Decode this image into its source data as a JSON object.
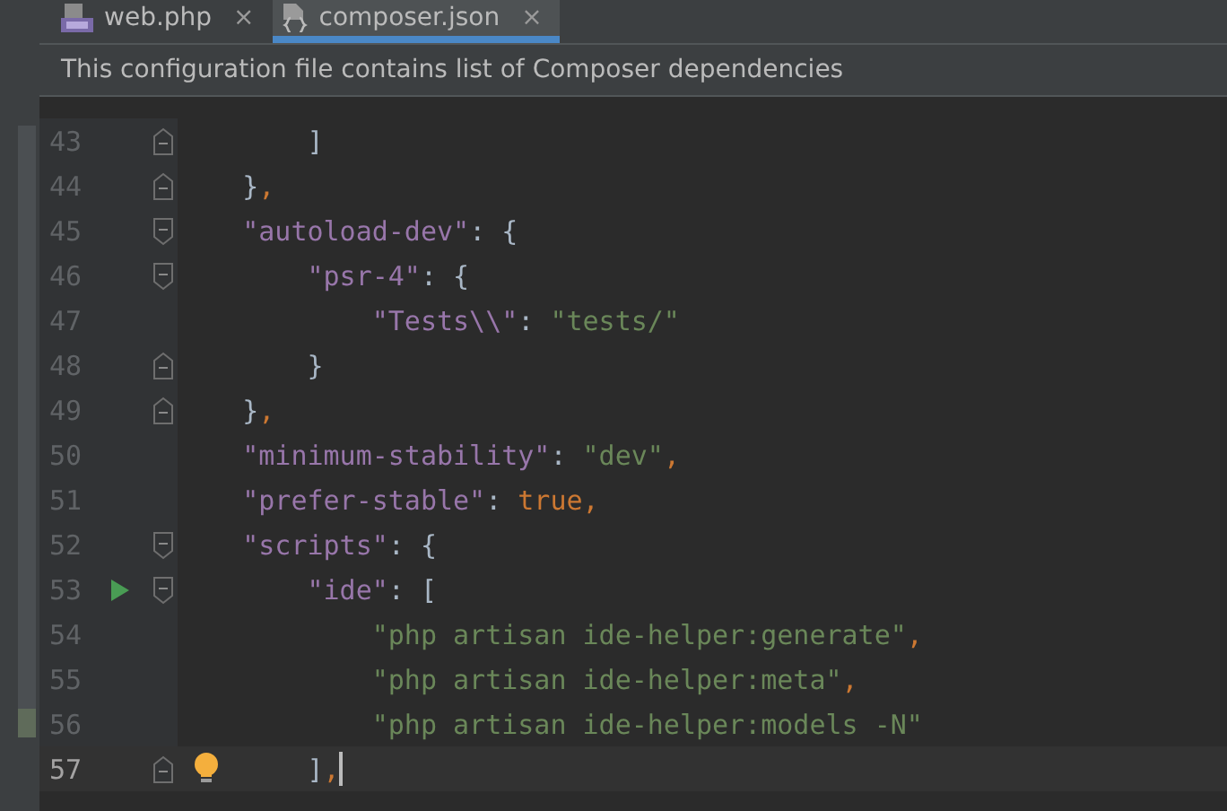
{
  "tabs": [
    {
      "label": "web.php",
      "kind": "php",
      "close": "×",
      "selected": false
    },
    {
      "label": "composer.json",
      "kind": "json",
      "close": "×",
      "selected": true
    }
  ],
  "banner": {
    "text": "This configuration file contains list of Composer dependencies"
  },
  "lines": [
    {
      "number": "43",
      "fold_open": false,
      "fold_close": true,
      "run": false,
      "current": false,
      "bulb": false,
      "tokens": [
        {
          "kind": "plain",
          "text": "        ]"
        }
      ]
    },
    {
      "number": "44",
      "fold_open": false,
      "fold_close": true,
      "run": false,
      "current": false,
      "bulb": false,
      "tokens": [
        {
          "kind": "plain",
          "text": "    }"
        },
        {
          "kind": "punct",
          "text": ","
        }
      ]
    },
    {
      "number": "45",
      "fold_open": true,
      "fold_close": false,
      "run": false,
      "current": false,
      "bulb": false,
      "tokens": [
        {
          "kind": "key",
          "text": "    \"autoload-dev\""
        },
        {
          "kind": "colon",
          "text": ": "
        },
        {
          "kind": "plain",
          "text": "{"
        }
      ]
    },
    {
      "number": "46",
      "fold_open": true,
      "fold_close": false,
      "run": false,
      "current": false,
      "bulb": false,
      "tokens": [
        {
          "kind": "key",
          "text": "        \"psr-4\""
        },
        {
          "kind": "colon",
          "text": ": "
        },
        {
          "kind": "plain",
          "text": "{"
        }
      ]
    },
    {
      "number": "47",
      "fold_open": false,
      "fold_close": false,
      "run": false,
      "current": false,
      "bulb": false,
      "tokens": [
        {
          "kind": "key",
          "text": "            \"Tests\\\\\""
        },
        {
          "kind": "colon",
          "text": ": "
        },
        {
          "kind": "string",
          "text": "\"tests/\""
        }
      ]
    },
    {
      "number": "48",
      "fold_open": false,
      "fold_close": true,
      "run": false,
      "current": false,
      "bulb": false,
      "tokens": [
        {
          "kind": "plain",
          "text": "        }"
        }
      ]
    },
    {
      "number": "49",
      "fold_open": false,
      "fold_close": true,
      "run": false,
      "current": false,
      "bulb": false,
      "tokens": [
        {
          "kind": "plain",
          "text": "    }"
        },
        {
          "kind": "punct",
          "text": ","
        }
      ]
    },
    {
      "number": "50",
      "fold_open": false,
      "fold_close": false,
      "run": false,
      "current": false,
      "bulb": false,
      "tokens": [
        {
          "kind": "key",
          "text": "    \"minimum-stability\""
        },
        {
          "kind": "colon",
          "text": ": "
        },
        {
          "kind": "string",
          "text": "\"dev\""
        },
        {
          "kind": "punct",
          "text": ","
        }
      ]
    },
    {
      "number": "51",
      "fold_open": false,
      "fold_close": false,
      "run": false,
      "current": false,
      "bulb": false,
      "tokens": [
        {
          "kind": "key",
          "text": "    \"prefer-stable\""
        },
        {
          "kind": "colon",
          "text": ": "
        },
        {
          "kind": "literal",
          "text": "true,"
        }
      ]
    },
    {
      "number": "52",
      "fold_open": true,
      "fold_close": false,
      "run": false,
      "current": false,
      "bulb": false,
      "tokens": [
        {
          "kind": "key",
          "text": "    \"scripts\""
        },
        {
          "kind": "colon",
          "text": ": "
        },
        {
          "kind": "plain",
          "text": "{"
        }
      ]
    },
    {
      "number": "53",
      "fold_open": true,
      "fold_close": false,
      "run": true,
      "current": false,
      "bulb": false,
      "tokens": [
        {
          "kind": "key",
          "text": "        \"ide\""
        },
        {
          "kind": "colon",
          "text": ": "
        },
        {
          "kind": "plain",
          "text": "["
        }
      ]
    },
    {
      "number": "54",
      "fold_open": false,
      "fold_close": false,
      "run": false,
      "current": false,
      "bulb": false,
      "tokens": [
        {
          "kind": "string",
          "text": "            \"php artisan ide-helper:generate\""
        },
        {
          "kind": "punct",
          "text": ","
        }
      ]
    },
    {
      "number": "55",
      "fold_open": false,
      "fold_close": false,
      "run": false,
      "current": false,
      "bulb": false,
      "tokens": [
        {
          "kind": "string",
          "text": "            \"php artisan ide-helper:meta\""
        },
        {
          "kind": "punct",
          "text": ","
        }
      ]
    },
    {
      "number": "56",
      "fold_open": false,
      "fold_close": false,
      "run": false,
      "current": false,
      "bulb": false,
      "tokens": [
        {
          "kind": "string",
          "text": "            \"php artisan ide-helper:models -N\""
        }
      ]
    },
    {
      "number": "57",
      "fold_open": false,
      "fold_close": true,
      "run": false,
      "current": true,
      "bulb": true,
      "tokens": [
        {
          "kind": "plain",
          "text": "        ]"
        },
        {
          "kind": "punct",
          "text": ","
        }
      ]
    }
  ]
}
